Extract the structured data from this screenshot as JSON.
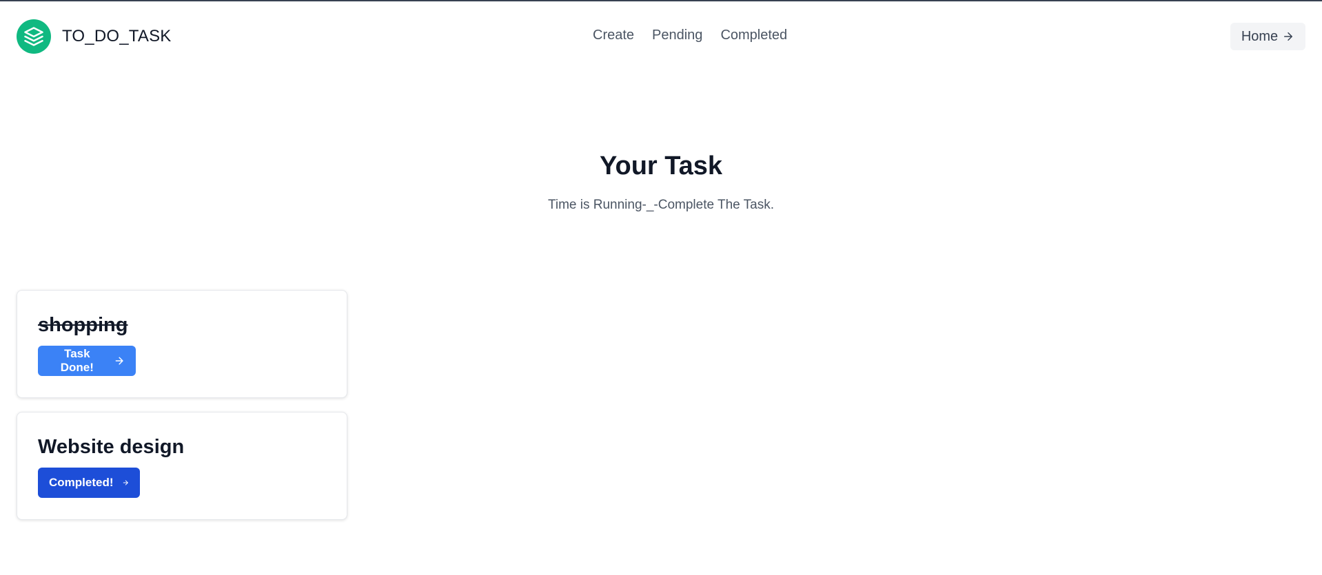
{
  "brand": {
    "name": "TO_DO_TASK",
    "logo_icon": "layers-icon",
    "logo_color": "#10b981"
  },
  "nav": {
    "items": [
      "Create",
      "Pending",
      "Completed"
    ]
  },
  "header_button": {
    "label": "Home",
    "icon": "arrow-right-icon"
  },
  "hero": {
    "title": "Your Task",
    "subtitle": "Time is Running-_-Complete The Task."
  },
  "tasks": [
    {
      "title": "shopping",
      "struck_through": true,
      "button_label": "Task Done!",
      "button_color": "#3b82f6"
    },
    {
      "title": "Website design",
      "struck_through": false,
      "button_label": "Completed!",
      "button_color": "#1d4ed8"
    }
  ]
}
